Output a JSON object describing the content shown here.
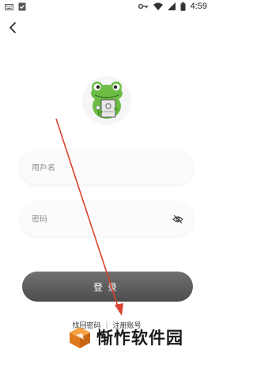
{
  "status_bar": {
    "time": "4:59",
    "icons": [
      "keyboard-icon",
      "shield-check-icon",
      "key-icon",
      "wifi-icon",
      "signal-icon",
      "battery-icon"
    ]
  },
  "header": {
    "back_icon": "chevron-left-icon"
  },
  "avatar": {
    "description": "frog-logo"
  },
  "form": {
    "username_placeholder": "用戶名",
    "password_placeholder": "密码",
    "password_toggle_icon": "eye-off-icon",
    "login_label": "登录"
  },
  "links": {
    "recover_password": "找回密码",
    "separator": "|",
    "register": "注册账号"
  },
  "watermark": {
    "text": "惭怍软件园"
  },
  "colors": {
    "button": "#5a5a5a",
    "annotation_arrow": "#d9432f",
    "watermark_orange": "#f08a24"
  }
}
